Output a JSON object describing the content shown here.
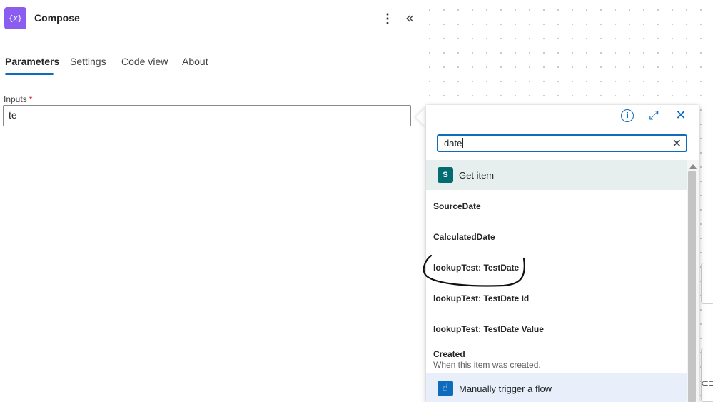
{
  "header": {
    "icon": "compose-braces-icon",
    "icon_glyph": "{𝑥}",
    "title": "Compose",
    "more_glyph": "⋮",
    "collapse_glyph": "«"
  },
  "tabs": [
    {
      "label": "Parameters",
      "active": true
    },
    {
      "label": "Settings",
      "active": false
    },
    {
      "label": "Code view",
      "active": false
    },
    {
      "label": "About",
      "active": false
    }
  ],
  "inputs": {
    "label": "Inputs",
    "required_marker": "*",
    "value": "te"
  },
  "popup": {
    "info_glyph": "i",
    "expand_glyph": "⤢",
    "close_glyph": "✕",
    "search": {
      "value": "date",
      "clear_glyph": "✕"
    },
    "groups": [
      {
        "label": "Get item",
        "logo": "sharepoint-icon",
        "logo_glyph": "S"
      },
      {
        "label": "Manually trigger a flow",
        "logo": "manual-trigger-icon",
        "logo_glyph": "☝"
      }
    ],
    "items": [
      {
        "name": "SourceDate"
      },
      {
        "name": "CalculatedDate"
      },
      {
        "name": "lookupTest: TestDate"
      },
      {
        "name": "lookupTest: TestDate Id"
      },
      {
        "name": "lookupTest: TestDate Value"
      },
      {
        "name": "Created",
        "description": "When this item was created."
      }
    ]
  },
  "canvas": {
    "link_glyph": "⊂⊃"
  },
  "colors": {
    "accent": "#0f6cbd",
    "compose_icon": "#8a5cf0",
    "sharepoint": "#036c70",
    "required": "#c50f1f"
  }
}
